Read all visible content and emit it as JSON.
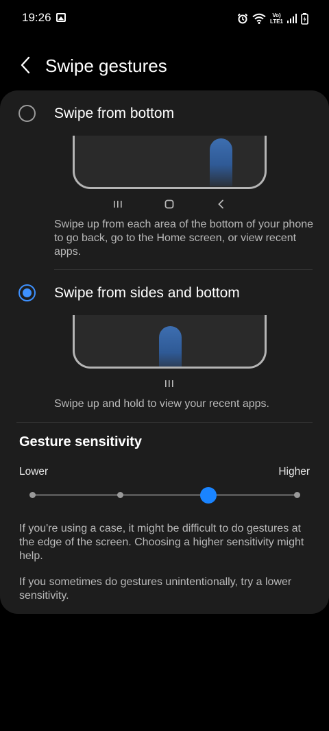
{
  "status_bar": {
    "time": "19:26",
    "icons": [
      "image-icon",
      "alarm-icon",
      "wifi-icon",
      "volte-icon",
      "signal-icon",
      "battery-icon"
    ],
    "volte_line1": "Vo)",
    "volte_line2": "LTE1"
  },
  "header": {
    "title": "Swipe gestures",
    "back_icon": "chevron-left-icon"
  },
  "options": [
    {
      "label": "Swipe from bottom",
      "selected": false,
      "description": "Swipe up from each area of the bottom of your phone to go back, go to the Home screen, or view recent apps.",
      "nav_icons": [
        "recents-icon",
        "home-icon",
        "back-icon"
      ]
    },
    {
      "label": "Swipe from sides and bottom",
      "selected": true,
      "description": "Swipe up and hold to view your recent apps.",
      "nav_icons": [
        "recents-icon"
      ]
    }
  ],
  "sensitivity": {
    "title": "Gesture sensitivity",
    "min_label": "Lower",
    "max_label": "Higher",
    "steps": 4,
    "value_index": 2,
    "notes": [
      "If you're using a case, it might be difficult to do gestures at the edge of the screen. Choosing a higher sensitivity might help.",
      "If you sometimes do gestures unintentionally, try a lower sensitivity."
    ]
  },
  "colors": {
    "accent": "#3e91ff",
    "card_bg": "#1d1d1d",
    "background": "#000000"
  }
}
